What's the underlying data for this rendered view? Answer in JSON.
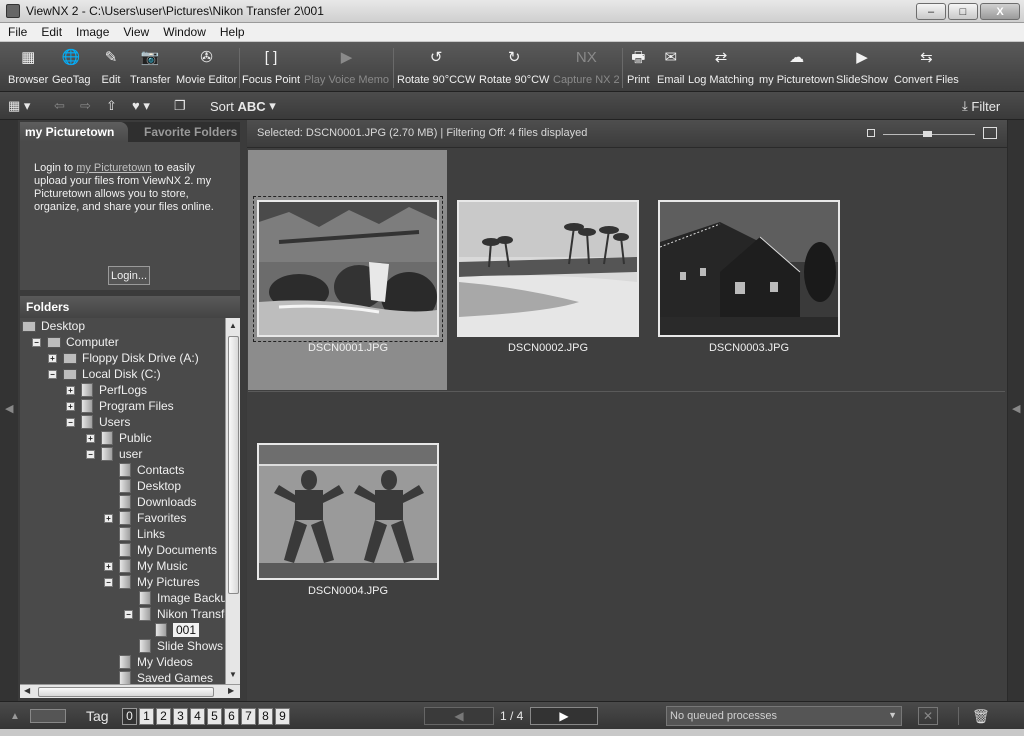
{
  "window": {
    "title": "ViewNX 2 - C:\\Users\\user\\Pictures\\Nikon Transfer 2\\001",
    "buttons": {
      "minimize": "–",
      "maximize": "□",
      "close": "X"
    }
  },
  "menu": [
    "File",
    "Edit",
    "Image",
    "View",
    "Window",
    "Help"
  ],
  "toolbar": [
    {
      "label": "Browser",
      "icon": "browser-icon",
      "glyph": "▦"
    },
    {
      "label": "GeoTag",
      "icon": "geotag-icon",
      "glyph": "🌐"
    },
    {
      "label": "Edit",
      "icon": "edit-icon",
      "glyph": "✎"
    },
    {
      "label": "Transfer",
      "icon": "camera-icon",
      "glyph": "📷"
    },
    {
      "label": "Movie Editor",
      "icon": "film-reel-icon",
      "glyph": "✇"
    },
    {
      "label": "Focus Point",
      "icon": "focus-point-icon",
      "glyph": "[ ]"
    },
    {
      "label": "Play Voice Memo",
      "icon": "play-voice-memo-icon",
      "glyph": "▶"
    },
    {
      "label": "Rotate 90°CCW",
      "icon": "rotate-ccw-icon",
      "glyph": "↺"
    },
    {
      "label": "Rotate 90°CW",
      "icon": "rotate-cw-icon",
      "glyph": "↻"
    },
    {
      "label": "Capture NX 2",
      "icon": "capture-nx-icon",
      "glyph": "NX"
    },
    {
      "label": "Print",
      "icon": "printer-icon",
      "glyph": "🖶"
    },
    {
      "label": "Email",
      "icon": "email-icon",
      "glyph": "✉"
    },
    {
      "label": "Log Matching",
      "icon": "log-matching-icon",
      "glyph": "⇄"
    },
    {
      "label": "my Picturetown",
      "icon": "picturetown-icon",
      "glyph": "☁"
    },
    {
      "label": "SlideShow",
      "icon": "slideshow-icon",
      "glyph": "▶"
    },
    {
      "label": "Convert Files",
      "icon": "convert-files-icon",
      "glyph": "⇆"
    }
  ],
  "toolbar2": {
    "sort_label": "Sort",
    "sort_mode": "ABC",
    "filter_label": "Filter"
  },
  "left_panel": {
    "tab_active": "my Picturetown",
    "tab_inactive": "Favorite Folders",
    "login_text_pre": "Login to ",
    "login_link": "my Picturetown",
    "login_text_post": " to easily upload your files from ViewNX 2. my Picturetown allows you to store, organize, and share your files online.",
    "login_button": "Login...",
    "folders_header": "Folders",
    "tree": [
      {
        "label": "Desktop",
        "kind": "desktop"
      },
      {
        "label": "Computer",
        "kind": "computer",
        "exp": "−"
      },
      {
        "label": "Floppy Disk Drive (A:)",
        "kind": "drive",
        "exp": "+"
      },
      {
        "label": "Local Disk (C:)",
        "kind": "drive",
        "exp": "−"
      },
      {
        "label": "PerfLogs",
        "kind": "folder",
        "exp": "+"
      },
      {
        "label": "Program Files",
        "kind": "folder",
        "exp": "+"
      },
      {
        "label": "Users",
        "kind": "folder",
        "exp": "−"
      },
      {
        "label": "Public",
        "kind": "folder",
        "exp": "+"
      },
      {
        "label": "user",
        "kind": "folder",
        "exp": "−"
      },
      {
        "label": "Contacts",
        "kind": "folder"
      },
      {
        "label": "Desktop",
        "kind": "folder"
      },
      {
        "label": "Downloads",
        "kind": "folder"
      },
      {
        "label": "Favorites",
        "kind": "folder",
        "exp": "+"
      },
      {
        "label": "Links",
        "kind": "folder"
      },
      {
        "label": "My Documents",
        "kind": "folder"
      },
      {
        "label": "My Music",
        "kind": "folder",
        "exp": "+"
      },
      {
        "label": "My Pictures",
        "kind": "folder",
        "exp": "−"
      },
      {
        "label": "Image Backup",
        "kind": "folder"
      },
      {
        "label": "Nikon Transfer",
        "kind": "folder",
        "exp": "−"
      },
      {
        "label": "001",
        "kind": "folder",
        "selected": true
      },
      {
        "label": "Slide Shows",
        "kind": "folder"
      },
      {
        "label": "My Videos",
        "kind": "folder"
      },
      {
        "label": "Saved Games",
        "kind": "folder"
      }
    ]
  },
  "main": {
    "info": "Selected: DSCN0001.JPG (2.70 MB) | Filtering Off: 4 files displayed",
    "thumbnails": [
      {
        "filename": "DSCN0001.JPG",
        "subject": "waterfall-photo",
        "selected": true
      },
      {
        "filename": "DSCN0002.JPG",
        "subject": "beach-palms-photo"
      },
      {
        "filename": "DSCN0003.JPG",
        "subject": "building-night-photo"
      },
      {
        "filename": "DSCN0004.JPG",
        "subject": "statues-photo"
      }
    ]
  },
  "bottom": {
    "tag_label": "Tag",
    "tags": [
      "0",
      "1",
      "2",
      "3",
      "4",
      "5",
      "6",
      "7",
      "8",
      "9"
    ],
    "page": "1 / 4",
    "queue": "No queued processes"
  }
}
